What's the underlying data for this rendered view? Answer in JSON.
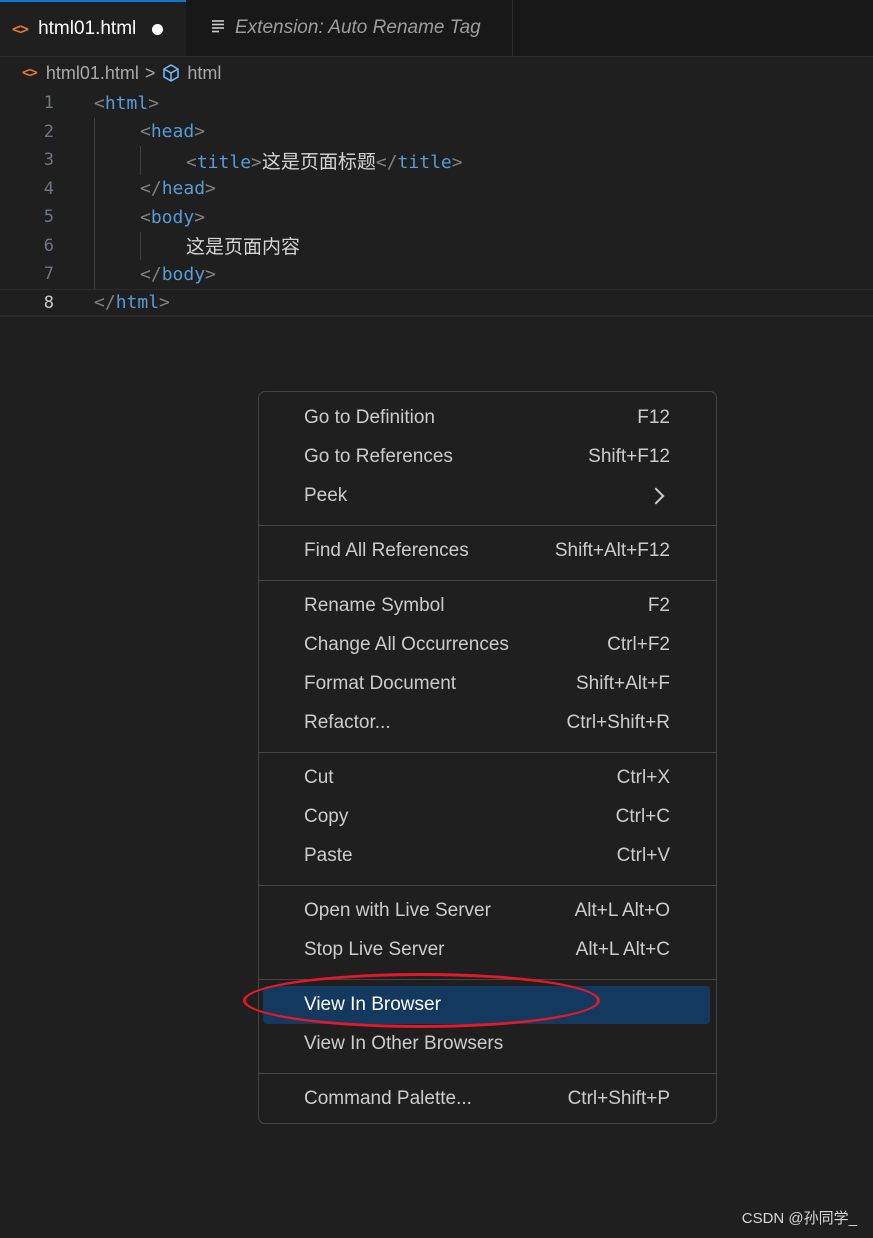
{
  "tabs": [
    {
      "label": "html01.html",
      "icon": "html-file-icon",
      "dirty": true,
      "active": true
    },
    {
      "label": "Extension: Auto Rename Tag",
      "icon": "extension-list-icon",
      "active": false
    }
  ],
  "breadcrumb": {
    "file": "html01.html",
    "separator": ">",
    "symbol": "html"
  },
  "editor": {
    "lines": [
      {
        "n": "1",
        "indent": 0,
        "tag_open": "html"
      },
      {
        "n": "2",
        "indent": 1,
        "tag_open": "head"
      },
      {
        "n": "3",
        "indent": 2,
        "tag_open": "title",
        "text": "这是页面标题",
        "tag_close": "title"
      },
      {
        "n": "4",
        "indent": 1,
        "tag_close": "head"
      },
      {
        "n": "5",
        "indent": 1,
        "tag_open": "body"
      },
      {
        "n": "6",
        "indent": 2,
        "text": "这是页面内容"
      },
      {
        "n": "7",
        "indent": 1,
        "tag_close": "body"
      },
      {
        "n": "8",
        "indent": 0,
        "tag_close": "html",
        "current": true
      }
    ]
  },
  "context_menu": {
    "groups": [
      [
        {
          "label": "Go to Definition",
          "shortcut": "F12"
        },
        {
          "label": "Go to References",
          "shortcut": "Shift+F12"
        },
        {
          "label": "Peek",
          "submenu": true
        }
      ],
      [
        {
          "label": "Find All References",
          "shortcut": "Shift+Alt+F12"
        }
      ],
      [
        {
          "label": "Rename Symbol",
          "shortcut": "F2"
        },
        {
          "label": "Change All Occurrences",
          "shortcut": "Ctrl+F2"
        },
        {
          "label": "Format Document",
          "shortcut": "Shift+Alt+F"
        },
        {
          "label": "Refactor...",
          "shortcut": "Ctrl+Shift+R"
        }
      ],
      [
        {
          "label": "Cut",
          "shortcut": "Ctrl+X"
        },
        {
          "label": "Copy",
          "shortcut": "Ctrl+C"
        },
        {
          "label": "Paste",
          "shortcut": "Ctrl+V"
        }
      ],
      [
        {
          "label": "Open with Live Server",
          "shortcut": "Alt+L Alt+O"
        },
        {
          "label": "Stop Live Server",
          "shortcut": "Alt+L Alt+C"
        }
      ],
      [
        {
          "label": "View In Browser",
          "shortcut": "",
          "highlighted": true
        },
        {
          "label": "View In Other Browsers",
          "shortcut": ""
        }
      ],
      [
        {
          "label": "Command Palette...",
          "shortcut": "Ctrl+Shift+P"
        }
      ]
    ]
  },
  "watermark": "CSDN @孙同学_",
  "colors": {
    "accent": "#0078d4",
    "highlight": "#133a5e",
    "annotation": "#e0192b",
    "tag": "#569cd6",
    "html_icon": "#e37933"
  }
}
